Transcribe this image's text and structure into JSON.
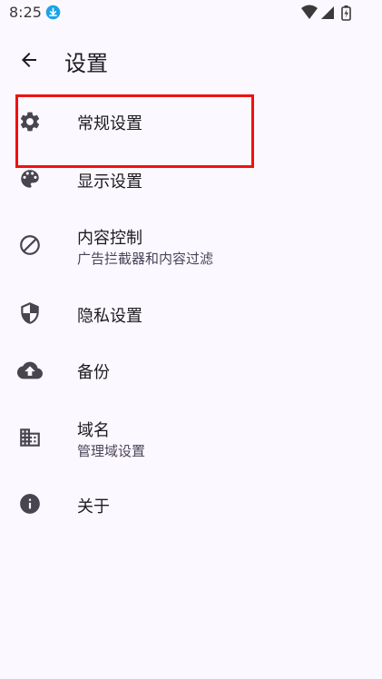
{
  "status_bar": {
    "time": "8:25",
    "icons": [
      "download-icon",
      "wifi-icon",
      "signal-icon",
      "battery-icon"
    ]
  },
  "header": {
    "title": "设置",
    "back_icon": "arrow-back-icon"
  },
  "items": [
    {
      "icon": "gear-icon",
      "title": "常规设置",
      "subtitle": ""
    },
    {
      "icon": "palette-icon",
      "title": "显示设置",
      "subtitle": ""
    },
    {
      "icon": "block-icon",
      "title": "内容控制",
      "subtitle": "广告拦截器和内容过滤"
    },
    {
      "icon": "shield-icon",
      "title": "隐私设置",
      "subtitle": ""
    },
    {
      "icon": "cloud-upload-icon",
      "title": "备份",
      "subtitle": ""
    },
    {
      "icon": "domain-icon",
      "title": "域名",
      "subtitle": "管理域设置"
    },
    {
      "icon": "info-icon",
      "title": "关于",
      "subtitle": ""
    }
  ],
  "colors": {
    "background": "#fcf8ff",
    "icon": "#49454f",
    "highlight": "#ee1111",
    "download_badge": "#1aa3e8"
  }
}
